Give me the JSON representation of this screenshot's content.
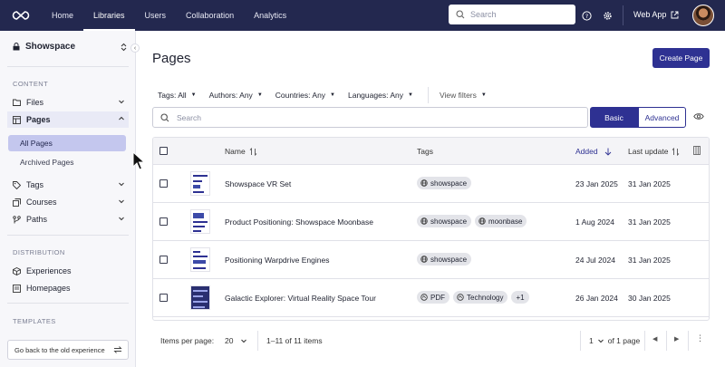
{
  "nav": {
    "items": [
      "Home",
      "Libraries",
      "Users",
      "Collaboration",
      "Analytics"
    ],
    "active": "Libraries",
    "search_placeholder": "Search",
    "web_app": "Web App"
  },
  "sidebar": {
    "space_name": "Showspace",
    "sections": {
      "content": "CONTENT",
      "distribution": "DISTRIBUTION",
      "templates": "TEMPLATES"
    },
    "items": {
      "files": "Files",
      "pages": "Pages",
      "all_pages": "All Pages",
      "archived_pages": "Archived Pages",
      "tags": "Tags",
      "courses": "Courses",
      "paths": "Paths",
      "experiences": "Experiences",
      "homepages": "Homepages"
    },
    "old_experience": "Go back to the old experience"
  },
  "main": {
    "title": "Pages",
    "create_button": "Create Page",
    "filters": {
      "tags": "Tags: All",
      "authors": "Authors: Any",
      "countries": "Countries: Any",
      "languages": "Languages: Any",
      "view_filters": "View filters"
    },
    "search_placeholder": "Search",
    "mode": {
      "basic": "Basic",
      "advanced": "Advanced",
      "selected": "Basic"
    },
    "table": {
      "headers": {
        "name": "Name",
        "tags": "Tags",
        "added": "Added",
        "last_update": "Last update"
      },
      "rows": [
        {
          "name": "Showspace VR Set",
          "tags": [
            "showspace"
          ],
          "added": "23 Jan 2025",
          "last_update": "31 Jan 2025"
        },
        {
          "name": "Product Positioning: Showspace Moonbase",
          "tags": [
            "showspace",
            "moonbase"
          ],
          "added": "1 Aug 2024",
          "last_update": "31 Jan 2025"
        },
        {
          "name": "Positioning Warpdrive Engines",
          "tags": [
            "showspace"
          ],
          "added": "24 Jul 2024",
          "last_update": "31 Jan 2025"
        },
        {
          "name": "Galactic Explorer: Virtual Reality Space Tour",
          "tags": [
            "PDF",
            "Technology"
          ],
          "more_tags": "+1",
          "added": "26 Jan 2024",
          "last_update": "30 Jan 2025"
        }
      ]
    },
    "footer": {
      "items_per_page_label": "Items per page:",
      "items_per_page": "20",
      "range": "1–11 of 11 items",
      "page": "1",
      "of_pages": "of 1 page"
    }
  },
  "colors": {
    "nav_bg": "#23284f",
    "accent": "#2e3192",
    "active_sub": "#c4c7ee"
  }
}
